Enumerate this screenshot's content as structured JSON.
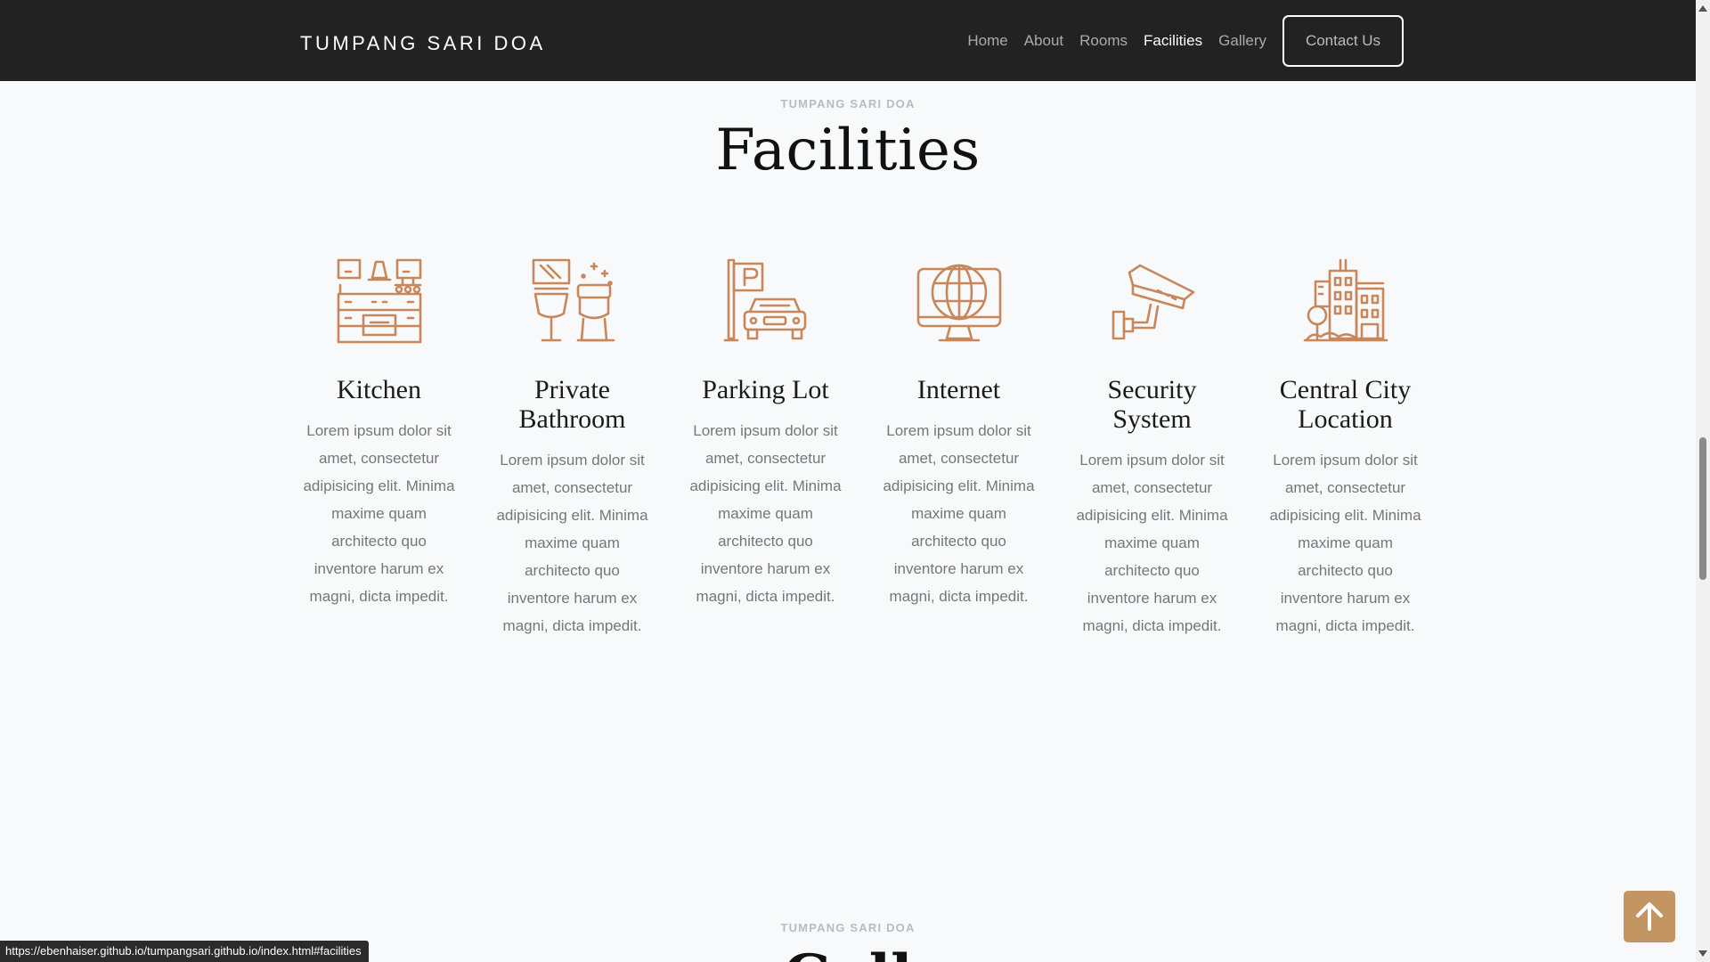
{
  "brand": "TUMPANG SARI DOA",
  "nav": {
    "items": [
      {
        "label": "Home",
        "active": false
      },
      {
        "label": "About",
        "active": false
      },
      {
        "label": "Rooms",
        "active": false
      },
      {
        "label": "Facilities",
        "active": true
      },
      {
        "label": "Gallery",
        "active": false
      }
    ],
    "contact_label": "Contact Us"
  },
  "facilities": {
    "eyebrow": "TUMPANG SARI DOA",
    "title": "Facilities",
    "cards": [
      {
        "icon": "kitchen-icon",
        "title": "Kitchen",
        "text": "Lorem ipsum dolor sit amet, consectetur adipisicing elit. Minima maxime quam architecto quo inventore harum ex magni, dicta impedit."
      },
      {
        "icon": "bathroom-icon",
        "title": "Private Bathroom",
        "text": "Lorem ipsum dolor sit amet, consectetur adipisicing elit. Minima maxime quam architecto quo inventore harum ex magni, dicta impedit."
      },
      {
        "icon": "parking-icon",
        "title": "Parking Lot",
        "text": "Lorem ipsum dolor sit amet, consectetur adipisicing elit. Minima maxime quam architecto quo inventore harum ex magni, dicta impedit."
      },
      {
        "icon": "internet-icon",
        "title": "Internet",
        "text": "Lorem ipsum dolor sit amet, consectetur adipisicing elit. Minima maxime quam architecto quo inventore harum ex magni, dicta impedit."
      },
      {
        "icon": "security-camera-icon",
        "title": "Security System",
        "text": "Lorem ipsum dolor sit amet, consectetur adipisicing elit. Minima maxime quam architecto quo inventore harum ex magni, dicta impedit."
      },
      {
        "icon": "city-buildings-icon",
        "title": "Central City Location",
        "text": "Lorem ipsum dolor sit amet, consectetur adipisicing elit. Minima maxime quam architecto quo inventore harum ex magni, dicta impedit."
      }
    ]
  },
  "gallery": {
    "eyebrow": "TUMPANG SARI DOA",
    "title_partial": "Gall"
  },
  "status_url": "https://ebenhaiser.github.io/tumpangsari.github.io/index.html#facilities",
  "colors": {
    "accent": "#c39563",
    "icon": "#c8875a",
    "navbar": "#222222"
  }
}
